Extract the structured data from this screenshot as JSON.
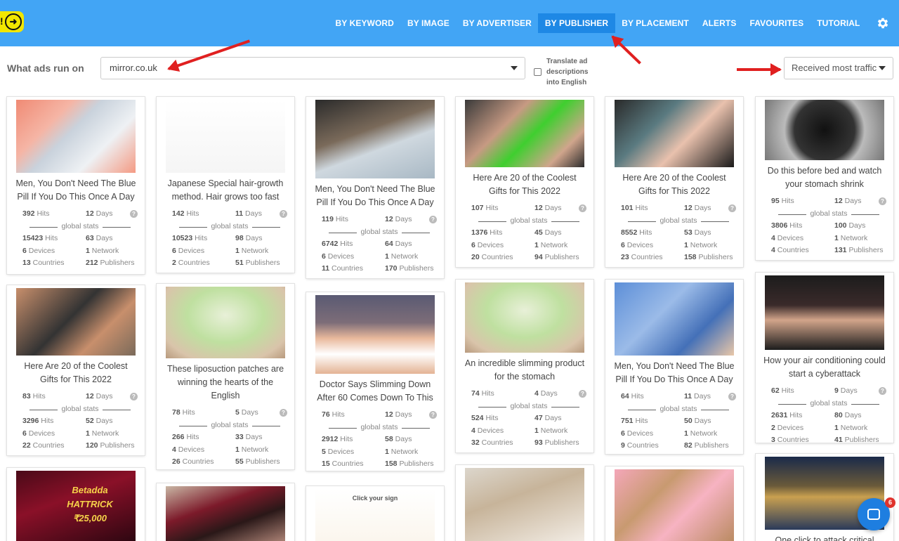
{
  "nav": {
    "items": [
      "BY KEYWORD",
      "BY IMAGE",
      "BY ADVERTISER",
      "BY PUBLISHER",
      "BY PLACEMENT",
      "ALERTS",
      "FAVOURITES",
      "TUTORIAL"
    ],
    "active": "BY PUBLISHER",
    "settings_icon": "gear-icon"
  },
  "logo": {
    "excl": "!",
    "icon": "arrow-right-circle-icon"
  },
  "filter": {
    "label": "What ads run on",
    "publisher_value": "mirror.co.uk",
    "translate_label": "Translate ad descriptions into English",
    "sort_value": "Received most traffic"
  },
  "labels": {
    "global_stats": "global stats"
  },
  "colors": {
    "topbar": "#42a5f5",
    "active_nav": "#1e88e5",
    "annotation_red": "#e02020",
    "chat": "#1e7ee0"
  },
  "cards": [
    {
      "title": "Men, You Don't Need The Blue Pill If You Do This Once A Day",
      "hits": "392",
      "days": "12",
      "g_hits": "15423",
      "g_days": "63",
      "devices": "6",
      "networks": "1",
      "countries": "13",
      "publishers": "212"
    },
    {
      "title": "Japanese Special hair-growth method. Hair grows too fast",
      "hits": "142",
      "days": "11",
      "g_hits": "10523",
      "g_days": "98",
      "devices": "6",
      "networks": "1",
      "countries": "2",
      "publishers": "51"
    },
    {
      "title": "Men, You Don't Need The Blue Pill If You Do This Once A Day",
      "hits": "119",
      "days": "12",
      "g_hits": "6742",
      "g_days": "64",
      "devices": "6",
      "networks": "1",
      "countries": "11",
      "publishers": "170"
    },
    {
      "title": "Here Are 20 of the Coolest Gifts for This 2022",
      "hits": "107",
      "days": "12",
      "g_hits": "1376",
      "g_days": "45",
      "devices": "6",
      "networks": "1",
      "countries": "20",
      "publishers": "94"
    },
    {
      "title": "Here Are 20 of the Coolest Gifts for This 2022",
      "hits": "101",
      "days": "12",
      "g_hits": "8552",
      "g_days": "53",
      "devices": "6",
      "networks": "1",
      "countries": "23",
      "publishers": "158"
    },
    {
      "title": "Do this before bed and watch your stomach shrink",
      "hits": "95",
      "days": "12",
      "g_hits": "3806",
      "g_days": "100",
      "devices": "4",
      "networks": "1",
      "countries": "4",
      "publishers": "131"
    },
    {
      "title": "Here Are 20 of the Coolest Gifts for This 2022",
      "hits": "83",
      "days": "12",
      "g_hits": "3296",
      "g_days": "52",
      "devices": "6",
      "networks": "1",
      "countries": "22",
      "publishers": "120"
    },
    {
      "title": "These liposuction patches are winning the hearts of the English",
      "hits": "78",
      "days": "5",
      "g_hits": "266",
      "g_days": "33",
      "devices": "4",
      "networks": "1",
      "countries": "26",
      "publishers": "55"
    },
    {
      "title": "Doctor Says Slimming Down After 60 Comes Down To This",
      "hits": "76",
      "days": "12",
      "g_hits": "2912",
      "g_days": "58",
      "devices": "5",
      "networks": "1",
      "countries": "15",
      "publishers": "158"
    },
    {
      "title": "An incredible slimming product for the stomach",
      "hits": "74",
      "days": "4",
      "g_hits": "524",
      "g_days": "47",
      "devices": "4",
      "networks": "1",
      "countries": "32",
      "publishers": "93"
    },
    {
      "title": "Men, You Don't Need The Blue Pill If You Do This Once A Day",
      "hits": "64",
      "days": "11",
      "g_hits": "751",
      "g_days": "50",
      "devices": "6",
      "networks": "1",
      "countries": "9",
      "publishers": "82"
    },
    {
      "title": "How your air conditioning could start a cyberattack",
      "hits": "62",
      "days": "9",
      "g_hits": "2631",
      "g_days": "80",
      "devices": "2",
      "networks": "1",
      "countries": "3",
      "publishers": "41"
    },
    {
      "title": "",
      "thumb_text": "Betadda HATTRICK ₹25,000"
    },
    {
      "title": ""
    },
    {
      "title": "",
      "thumb_text": "Click your sign"
    },
    {
      "title": ""
    },
    {
      "title": ""
    },
    {
      "title": "One click to attack critical"
    }
  ],
  "stat_words": {
    "hits": "Hits",
    "days": "Days",
    "devices": "Devices",
    "network": "Network",
    "countries": "Countries",
    "publishers": "Publishers"
  },
  "chat": {
    "badge": "6",
    "icon": "chat-bubble-icon"
  }
}
